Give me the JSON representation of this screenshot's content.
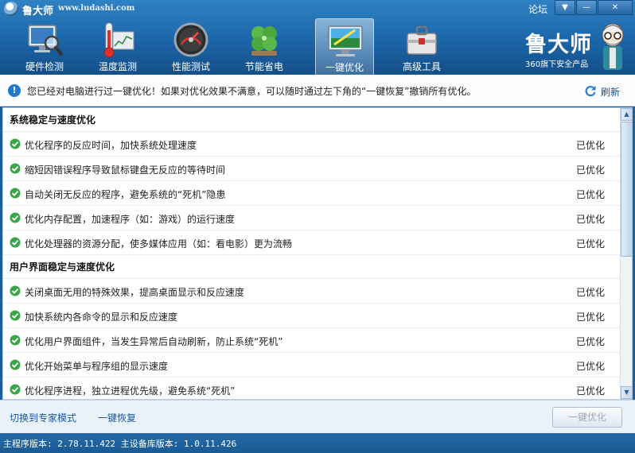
{
  "app": {
    "title": "鲁大师",
    "url": "www.ludashi.com",
    "forum": "论坛",
    "menu_glyph": "▼",
    "minimize_glyph": "—",
    "close_glyph": "✕"
  },
  "nav": {
    "items": [
      {
        "label": "硬件检测",
        "icon": "monitor-magnifier-icon"
      },
      {
        "label": "温度监测",
        "icon": "thermometer-icon"
      },
      {
        "label": "性能测试",
        "icon": "speedometer-icon"
      },
      {
        "label": "节能省电",
        "icon": "clover-icon"
      },
      {
        "label": "一键优化",
        "icon": "monitor-optimize-icon",
        "active": true
      },
      {
        "label": "高级工具",
        "icon": "toolbox-icon"
      }
    ]
  },
  "brand": {
    "name": "鲁大师",
    "subtitle": "360旗下安全产品",
    "mascot": "mascot-icon"
  },
  "notice": {
    "text": "您已经对电脑进行过一键优化！如果对优化效果不满意，可以随时通过左下角的“一键恢复”撤销所有优化。",
    "refresh_label": "刷新"
  },
  "sections": [
    {
      "title": "系统稳定与速度优化",
      "items": [
        {
          "text": "优化程序的反应时间，加快系统处理速度",
          "status": "已优化"
        },
        {
          "text": "缩短因错误程序导致鼠标键盘无反应的等待时间",
          "status": "已优化"
        },
        {
          "text": "自动关闭无反应的程序，避免系统的“死机”隐患",
          "status": "已优化"
        },
        {
          "text": "优化内存配置，加速程序（如：游戏）的运行速度",
          "status": "已优化"
        },
        {
          "text": "优化处理器的资源分配，使多媒体应用（如：看电影）更为流畅",
          "status": "已优化"
        }
      ]
    },
    {
      "title": "用户界面稳定与速度优化",
      "items": [
        {
          "text": "关闭桌面无用的特殊效果，提高桌面显示和反应速度",
          "status": "已优化"
        },
        {
          "text": "加快系统内各命令的显示和反应速度",
          "status": "已优化"
        },
        {
          "text": "优化用户界面组件，当发生异常后自动刷新，防止系统“死机”",
          "status": "已优化"
        },
        {
          "text": "优化开始菜单与程序组的显示速度",
          "status": "已优化"
        },
        {
          "text": "优化程序进程，独立进程优先级，避免系统“死机”",
          "status": "已优化"
        }
      ]
    }
  ],
  "scrollbar": {
    "up_glyph": "▲",
    "down_glyph": "▼"
  },
  "footer": {
    "expert_mode": "切换到专家模式",
    "restore": "一键恢复",
    "optimize_button": "一键优化"
  },
  "statusbar": {
    "text": "主程序版本: 2.78.11.422  主设备库版本: 1.0.11.426"
  }
}
